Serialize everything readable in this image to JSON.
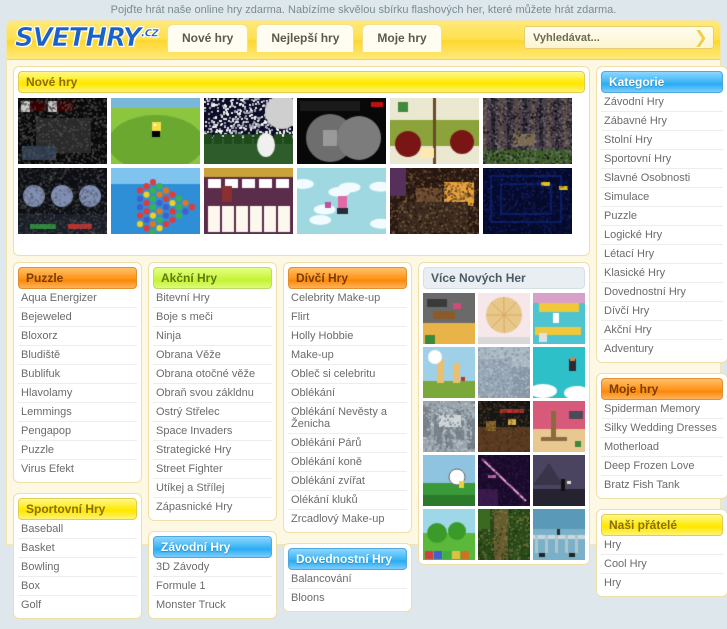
{
  "top_banner": "Pojďte hrát naše online hry zdarma. Nabízíme skvělou sbírku flashových her, které můžete hrát zdarma.",
  "header": {
    "logo_main": "SVETHRY",
    "logo_tld": ".cz",
    "tabs": [
      {
        "label": "Nové hry"
      },
      {
        "label": "Nejlepší hry"
      },
      {
        "label": "Moje hry"
      }
    ],
    "search": {
      "value": "Vyhledávat...",
      "placeholder": "Vyhledávat...",
      "arrow_icon": "chevron-right-icon"
    }
  },
  "new_games": {
    "title": "Nové hry",
    "thumbnails": [
      {
        "name": "dark-shooter-game"
      },
      {
        "name": "green-hill-cat-game"
      },
      {
        "name": "night-forest-game"
      },
      {
        "name": "grey-spheres-game"
      },
      {
        "name": "flower-field-game"
      },
      {
        "name": "dark-woods-game"
      },
      {
        "name": "dark-machines-game"
      },
      {
        "name": "jewel-match-game"
      },
      {
        "name": "solitaire-card-game"
      },
      {
        "name": "ice-penguin-game"
      },
      {
        "name": "cluttered-room-game"
      },
      {
        "name": "blue-maze-game"
      }
    ]
  },
  "panels": {
    "puzzle": {
      "title": "Puzzle",
      "theme": "orange",
      "items": [
        "Aqua Energizer",
        "Bejeweled",
        "Bloxorz",
        "Bludiště",
        "Bublifuk",
        "Hlavolamy",
        "Lemmings",
        "Pengapop",
        "Puzzle",
        "Virus Efekt"
      ]
    },
    "sportovni": {
      "title": "Sportovní Hry",
      "theme": "yellow",
      "items": [
        "Baseball",
        "Basket",
        "Bowling",
        "Box",
        "Golf"
      ]
    },
    "akcni": {
      "title": "Akční Hry",
      "theme": "green",
      "items": [
        "Bitevní Hry",
        "Boje s meči",
        "Ninja",
        "Obrana Věže",
        "Obrana otočné věže",
        "Obraň svou zákldnu",
        "Ostrý Střelec",
        "Space Invaders",
        "Strategické Hry",
        "Street Fighter",
        "Utíkej a Střílej",
        "Zápasnické Hry"
      ]
    },
    "zavodni": {
      "title": "Závodní Hry",
      "theme": "blue",
      "items": [
        "3D Závody",
        "Formule 1",
        "Monster Truck"
      ]
    },
    "divci": {
      "title": "Dívčí Hry",
      "theme": "orange",
      "items": [
        "Celebrity Make-up",
        "Flirt",
        "Holly Hobbie",
        "Make-up",
        "Obleč si celebritu",
        "Oblékání",
        "Oblékání Nevěsty a Ženicha",
        "Oblékání Párů",
        "Oblékání koně",
        "Oblékání zvířat",
        "Olékání kluků",
        "Zrcadlový Make-up"
      ]
    },
    "dovednostni": {
      "title": "Dovednostní Hry",
      "theme": "blue",
      "items": [
        "Balancování",
        "Bloons"
      ]
    },
    "more_games": {
      "title": "Více Nových Her",
      "theme": "grey",
      "thumbnails": [
        {
          "name": "town-map-game"
        },
        {
          "name": "pizza-pie-game"
        },
        {
          "name": "yellow-platform-game"
        },
        {
          "name": "sky-pillars-game"
        },
        {
          "name": "grey-tower-game"
        },
        {
          "name": "teal-sky-jumper-game"
        },
        {
          "name": "grey-city-game"
        },
        {
          "name": "dark-mine-game"
        },
        {
          "name": "desert-rig-game"
        },
        {
          "name": "golf-course-game"
        },
        {
          "name": "purple-laser-game"
        },
        {
          "name": "dark-cave-game"
        },
        {
          "name": "green-train-game"
        },
        {
          "name": "jungle-path-game"
        },
        {
          "name": "sea-bridge-game"
        }
      ]
    }
  },
  "rail": {
    "kategorie": {
      "title": "Kategorie",
      "theme": "blue",
      "items": [
        "Závodní Hry",
        "Zábavné Hry",
        "Stolní Hry",
        "Sportovní Hry",
        "Slavné Osobnosti",
        "Simulace",
        "Puzzle",
        "Logické Hry",
        "Létací Hry",
        "Klasické Hry",
        "Dovednostní Hry",
        "Dívčí Hry",
        "Akční Hry",
        "Adventury"
      ]
    },
    "moje_hry": {
      "title": "Moje hry",
      "theme": "orange",
      "items": [
        "Spiderman Memory",
        "Silky Wedding Dresses",
        "Motherload",
        "Deep Frozen Love",
        "Bratz Fish Tank"
      ]
    },
    "pratele": {
      "title": "Naši přátelé",
      "theme": "yellow",
      "items": [
        "Hry",
        "Cool Hry",
        "Hry"
      ]
    }
  },
  "colors": {
    "page_bg": "#dde7ec",
    "frame_bg": "#fdf8e3",
    "header_yellow": "#ffe04e",
    "logo_blue": "#1a62c8",
    "accent_orange": "#ff9317",
    "accent_blue": "#35b3f5",
    "accent_green": "#c9f53a"
  }
}
